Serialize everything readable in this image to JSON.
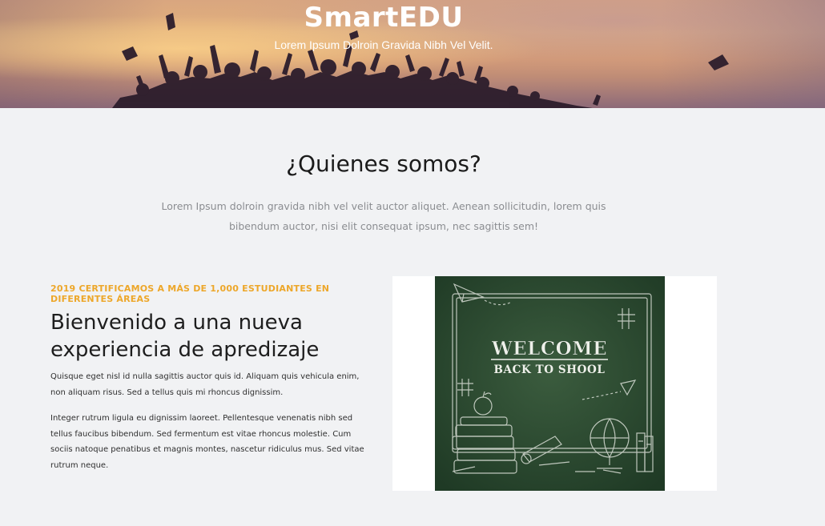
{
  "hero": {
    "title": "SmartEDU",
    "subtitle": "Lorem Ipsum Dolroin Gravida Nibh Vel Velit."
  },
  "about": {
    "title": "¿Quienes somos?",
    "text": "Lorem Ipsum dolroin gravida nibh vel velit auctor aliquet. Aenean sollicitudin, lorem quis bibendum auctor, nisi elit consequat ipsum, nec sagittis sem!"
  },
  "feature": {
    "eyebrow": "2019 certificamos a más de 1,000 estudiantes en diferentes áreas",
    "title": "Bienvenido a una nueva experiencia de apredizaje",
    "paragraph1": "Quisque eget nisl id nulla sagittis auctor quis id. Aliquam quis vehicula enim, non aliquam risus. Sed a tellus quis mi rhoncus dignissim.",
    "paragraph2": "Integer rutrum ligula eu dignissim laoreet. Pellentesque venenatis nibh sed tellus faucibus bibendum. Sed fermentum est vitae rhoncus molestie. Cum sociis natoque penatibus et magnis montes, nascetur ridiculus mus. Sed vitae rutrum neque."
  },
  "chalkboard": {
    "line1": "WELCOME",
    "line2": "BACK TO SHOOL"
  },
  "colors": {
    "accent": "#eda72a",
    "background": "#f1f2f4",
    "chalkboard": "#2b4a30"
  }
}
